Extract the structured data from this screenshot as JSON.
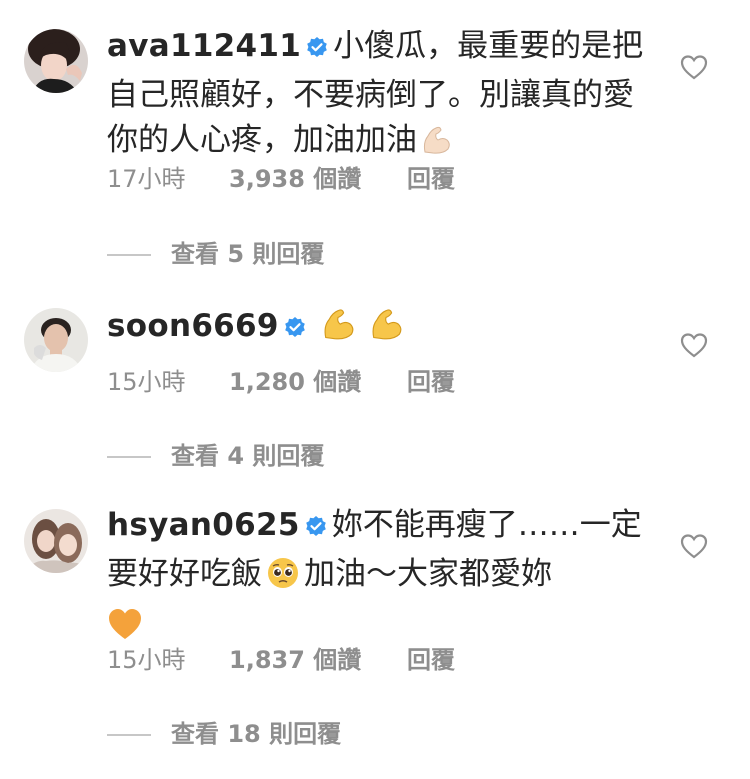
{
  "comments": [
    {
      "username": "ava112411",
      "verified": true,
      "text": "小傻瓜，最重要的是把自己照顧好，不要病倒了。別讓真的愛你的人心疼，加油加油",
      "emoji": "flexed-biceps",
      "time": "17小時",
      "likes": "3,938 個讚",
      "reply_label": "回覆",
      "view_replies": "查看 5 則回覆"
    },
    {
      "username": "soon6669",
      "verified": true,
      "text": "",
      "emoji": "flexed-biceps x2",
      "time": "15小時",
      "likes": "1,280 個讚",
      "reply_label": "回覆",
      "view_replies": "查看 4 則回覆"
    },
    {
      "username": "hsyan0625",
      "verified": true,
      "text_part1": "妳不能再瘦了……一定要好好吃飯",
      "text_part2": "加油～大家都愛妳",
      "emoji": "pleading-face, orange-heart",
      "time": "15小時",
      "likes": "1,837 個讚",
      "reply_label": "回覆",
      "view_replies": "查看 18 則回覆"
    }
  ],
  "colors": {
    "text": "#262626",
    "secondary": "#8e8e8e",
    "verified": "#3897f0",
    "divider": "#c7c7c7"
  }
}
